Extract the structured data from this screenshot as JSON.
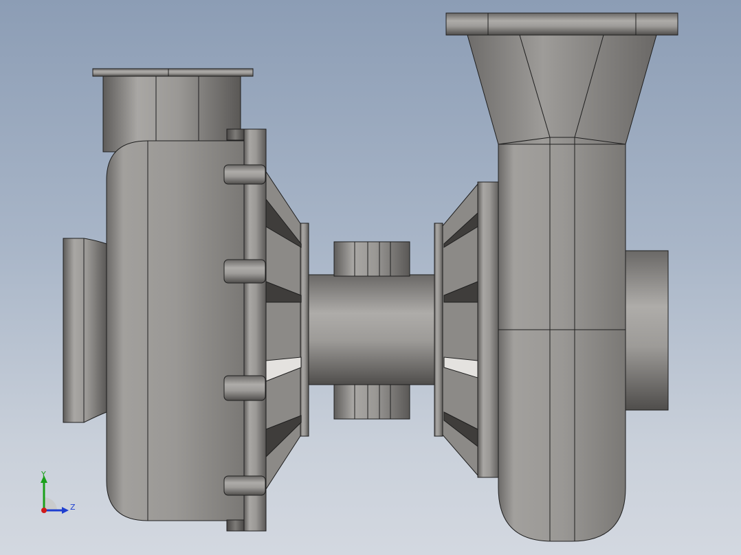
{
  "viewport": {
    "background_top": "#8c9db5",
    "background_bottom": "#d3d8e0"
  },
  "model": {
    "part_color_light": "#a9a7a4",
    "part_color_dark": "#4a4846",
    "edge_color": "#1e1e1e"
  },
  "triad": {
    "y_label": "Y",
    "z_label": "Z",
    "y_color": "#1aa01a",
    "z_color": "#1f3fd0",
    "x_color": "#d01a1a"
  }
}
